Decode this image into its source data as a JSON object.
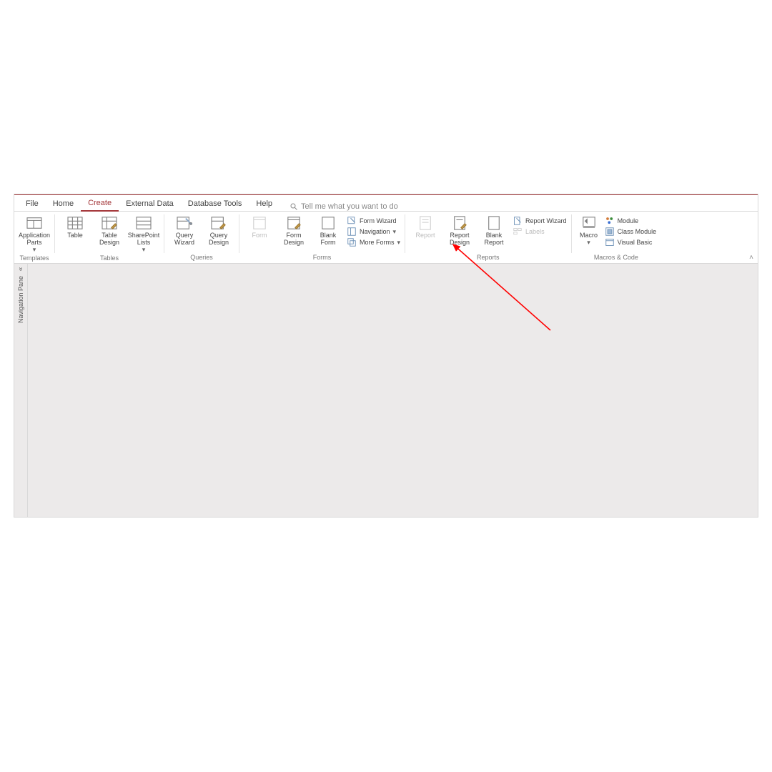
{
  "ribbon": {
    "tabs": [
      "File",
      "Home",
      "Create",
      "External Data",
      "Database Tools",
      "Help"
    ],
    "active_tab": "Create",
    "search_placeholder": "Tell me what you want to do"
  },
  "groups": {
    "templates": {
      "label": "Templates",
      "application_parts": "Application\nParts"
    },
    "tables": {
      "label": "Tables",
      "table": "Table",
      "table_design": "Table\nDesign",
      "sharepoint_lists": "SharePoint\nLists"
    },
    "queries": {
      "label": "Queries",
      "query_wizard": "Query\nWizard",
      "query_design": "Query\nDesign"
    },
    "forms": {
      "label": "Forms",
      "form": "Form",
      "form_design": "Form\nDesign",
      "blank_form": "Blank\nForm",
      "form_wizard": "Form Wizard",
      "navigation": "Navigation",
      "more_forms": "More Forms"
    },
    "reports": {
      "label": "Reports",
      "report": "Report",
      "report_design": "Report\nDesign",
      "blank_report": "Blank\nReport",
      "report_wizard": "Report Wizard",
      "labels": "Labels"
    },
    "macros": {
      "label": "Macros & Code",
      "macro": "Macro",
      "module": "Module",
      "class_module": "Class Module",
      "visual_basic": "Visual Basic"
    }
  },
  "nav_pane_label": "Navigation Pane",
  "colors": {
    "accent": "#a4373a",
    "arrow": "#ff0000"
  }
}
